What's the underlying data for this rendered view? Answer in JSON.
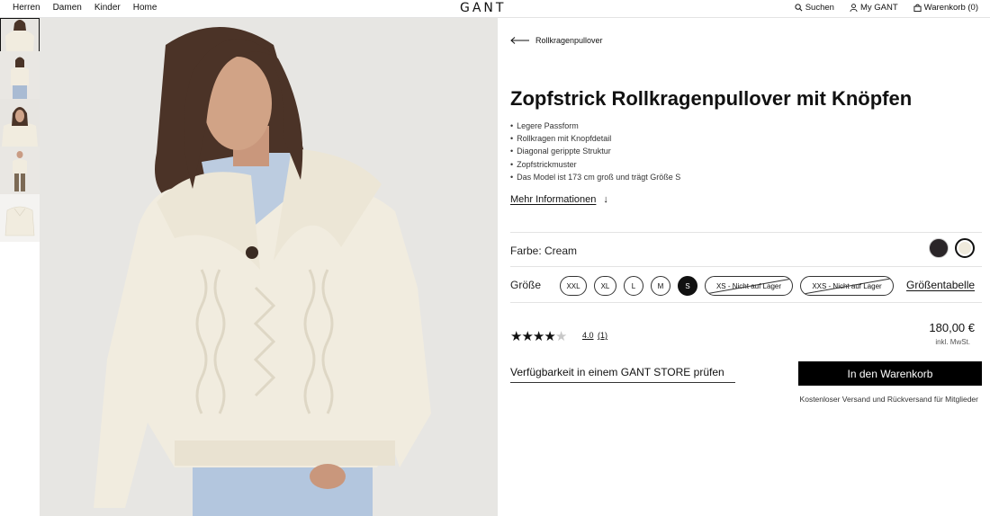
{
  "header": {
    "nav": [
      "Herren",
      "Damen",
      "Kinder",
      "Home"
    ],
    "logo": "GANT",
    "search_label": "Suchen",
    "account_label": "My GANT",
    "cart_label": "Warenkorb (0)"
  },
  "product": {
    "back_label": "Rollkragenpullover",
    "title": "Zopfstrick Rollkragenpullover mit Knöpfen",
    "features": [
      "Legere Passform",
      "Rollkragen mit Knopfdetail",
      "Diagonal gerippte Struktur",
      "Zopfstrickmuster",
      "Das Model ist 173 cm groß und trägt Größe S"
    ],
    "more_info_label": "Mehr Informationen",
    "color_label": "Farbe: Cream",
    "colors": [
      "#2a2528",
      "#efeadc"
    ],
    "size_label": "Größe",
    "sizes": [
      "XXL",
      "XL",
      "L",
      "M",
      "S",
      "XS - Nicht auf Lager",
      "XXS - Nicht auf Lager"
    ],
    "selected_size": "S",
    "size_chart_label": "Größentabelle",
    "rating_value": "4.0",
    "rating_count": "(1)",
    "stars": 4,
    "price": "180,00 €",
    "vat_note": "inkl. MwSt.",
    "store_label": "Verfügbarkeit in einem GANT STORE prüfen",
    "cart_button": "In den Warenkorb",
    "shipping_note": "Kostenloser Versand und Rückversand für Mitglieder"
  }
}
